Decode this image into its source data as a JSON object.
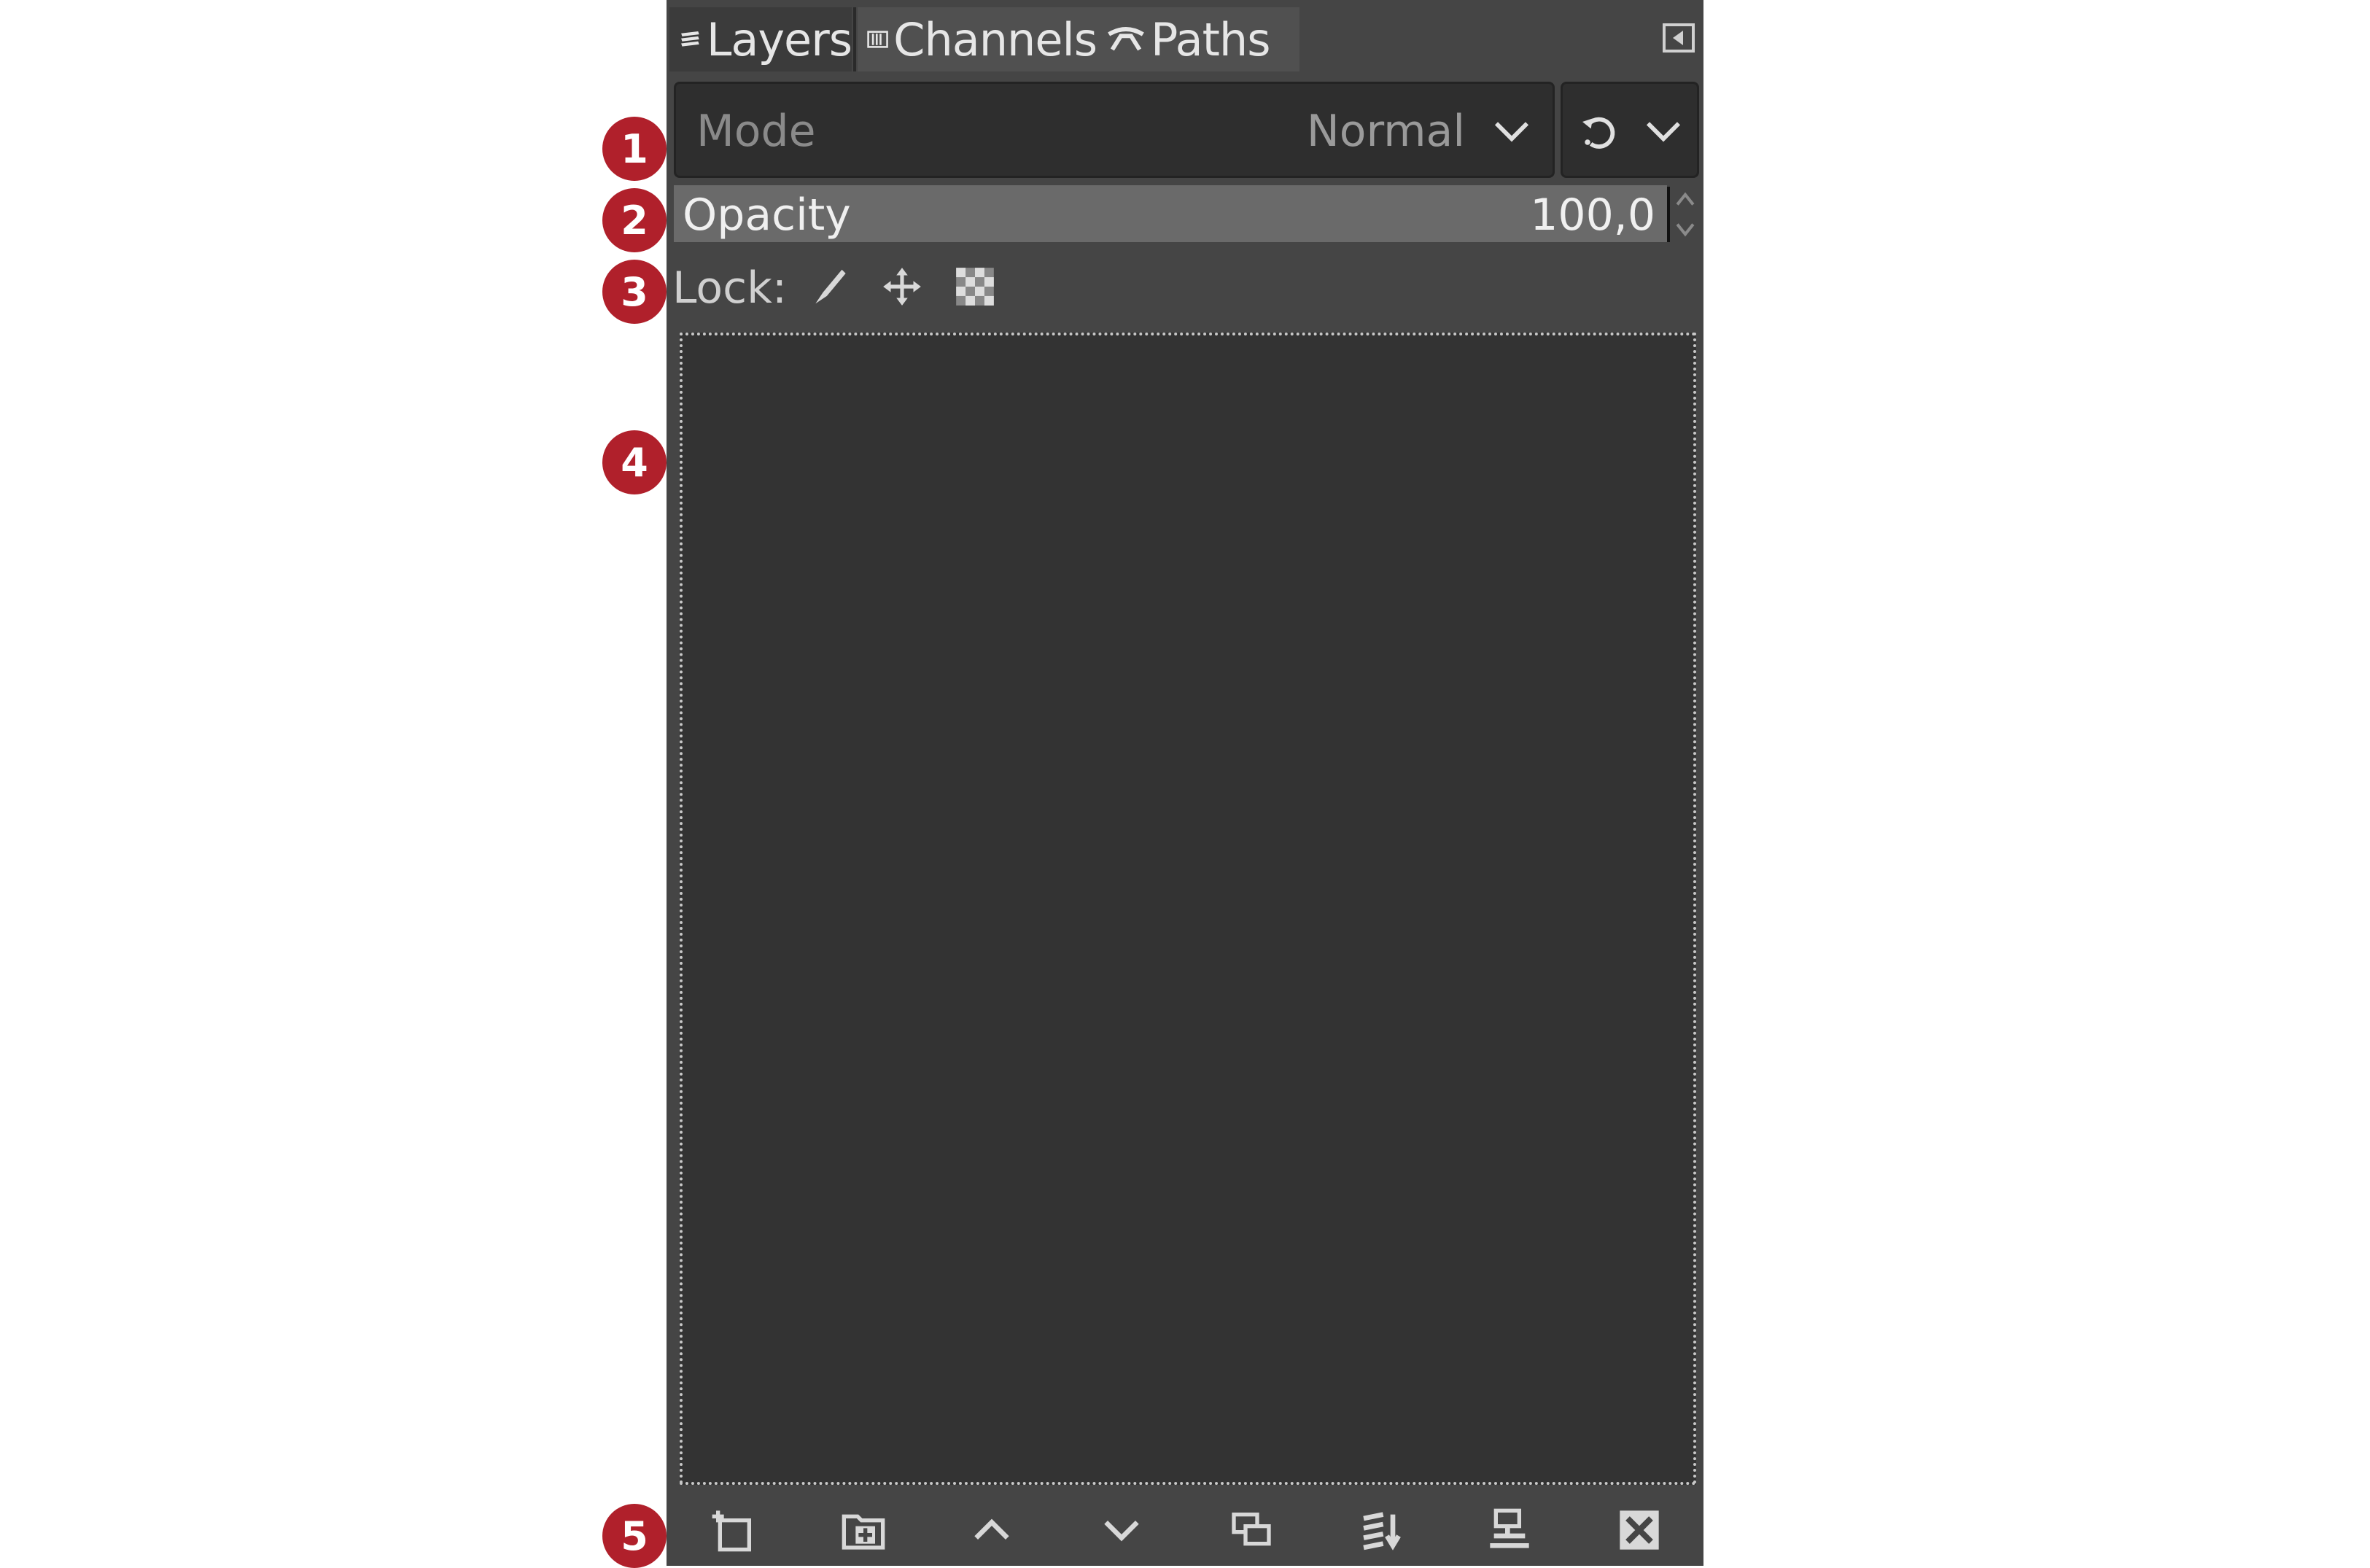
{
  "tabs": [
    {
      "label": "Layers",
      "icon": "layers-icon",
      "active": true
    },
    {
      "label": "Channels",
      "icon": "channels-icon",
      "active": false
    },
    {
      "label": "Paths",
      "icon": "paths-icon",
      "active": false
    }
  ],
  "mode": {
    "label": "Mode",
    "value": "Normal"
  },
  "opacity": {
    "label": "Opacity",
    "value": "100,0"
  },
  "lock": {
    "label": "Lock:",
    "icons": [
      "lock-pixels-icon",
      "lock-position-icon",
      "lock-alpha-icon"
    ]
  },
  "bottom_buttons": [
    "new-layer-icon",
    "new-layer-group-icon",
    "raise-layer-icon",
    "lower-layer-icon",
    "duplicate-layer-icon",
    "merge-layer-icon",
    "anchor-layer-icon",
    "delete-layer-icon"
  ],
  "markers": [
    "1",
    "2",
    "3",
    "4",
    "5"
  ],
  "colors": {
    "panel": "#454545",
    "list_bg": "#333333",
    "marker": "#b0202b",
    "opacity_bar": "#6a6a6a"
  }
}
